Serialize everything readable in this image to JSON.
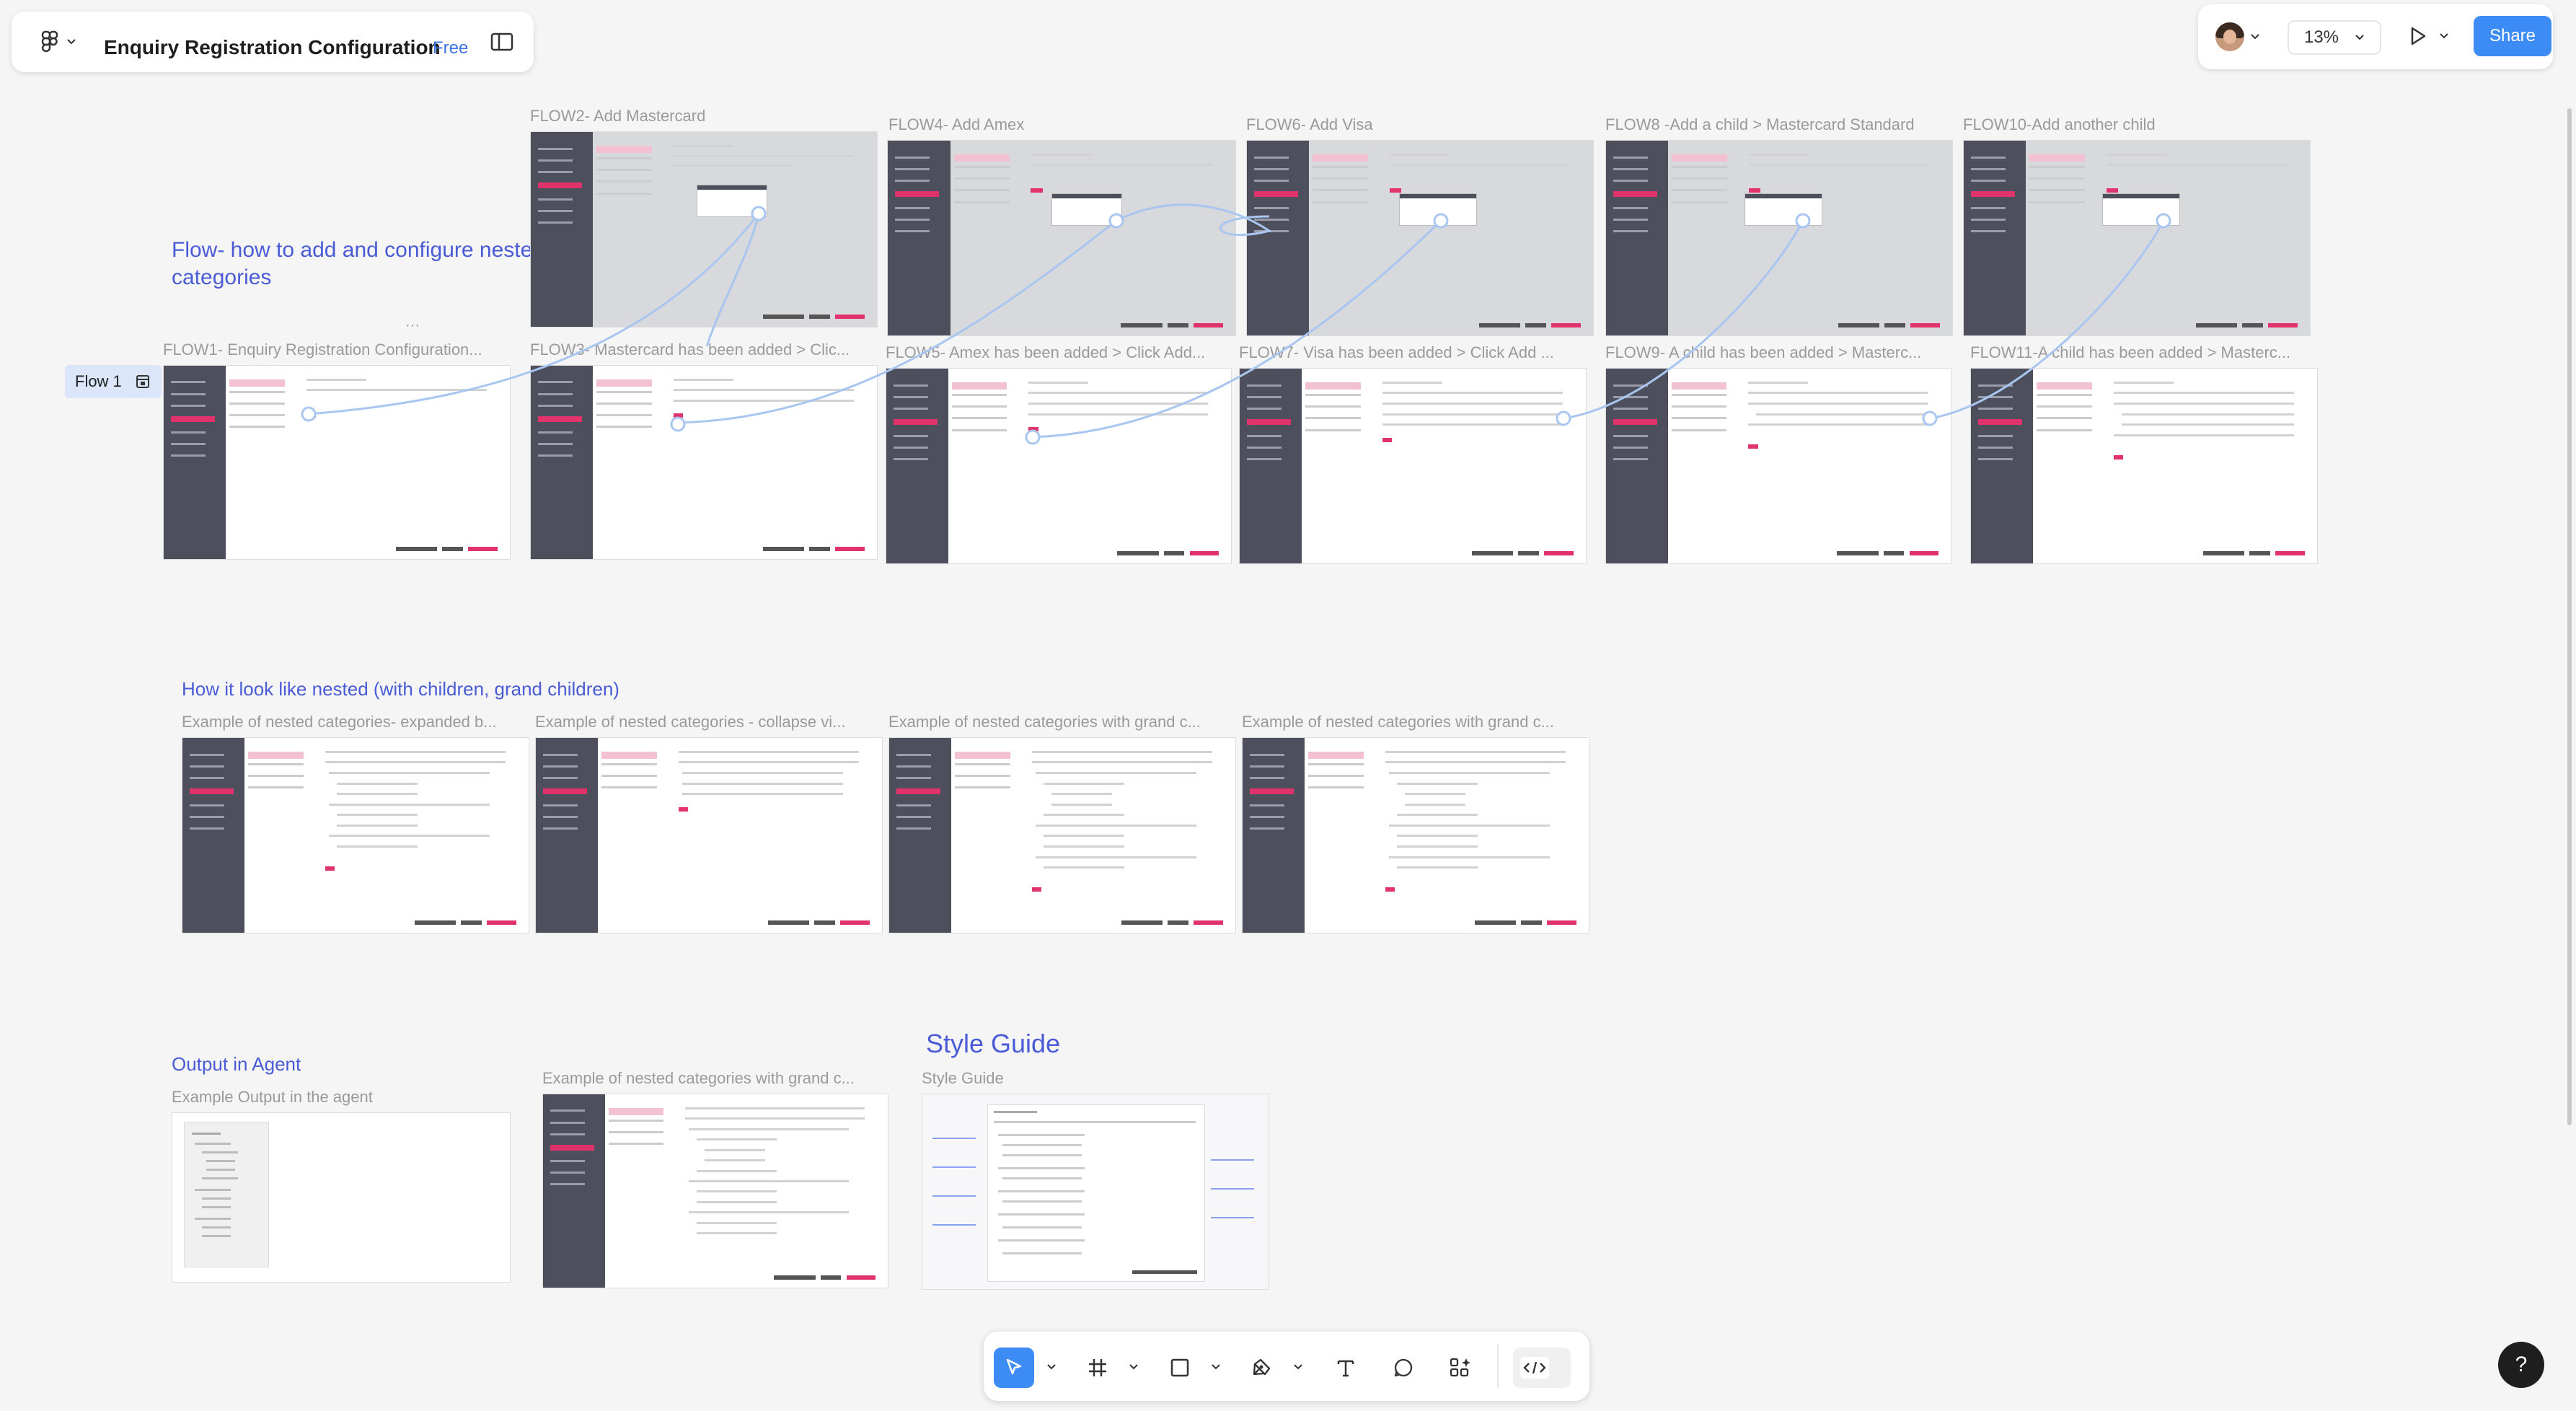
{
  "header": {
    "file_title": "Enquiry Registration Configuration",
    "plan_badge": "Free",
    "zoom": "13%",
    "share_label": "Share"
  },
  "canvas": {
    "flow_heading": "Flow- how to add and configure nested categories",
    "flow_tag": "Flow 1",
    "nested_heading": "How it look like nested (with children, grand children)",
    "output_heading": "Output in Agent",
    "style_heading": "Style Guide",
    "frames": {
      "flow1": "FLOW1-  Enquiry Registration Configuration...",
      "flow2": "FLOW2- Add Mastercard",
      "flow3": "FLOW3- Mastercard has been added > Clic...",
      "flow4": "FLOW4- Add Amex",
      "flow5": "FLOW5- Amex has been added > Click Add...",
      "flow6": "FLOW6- Add Visa",
      "flow7": "FLOW7- Visa has been added > Click Add ...",
      "flow8": "FLOW8 -Add a child  > Mastercard Standard",
      "flow9": "FLOW9- A child has been added > Masterc...",
      "flow10": "FLOW10-Add another child",
      "flow11": "FLOW11-A child has been added > Masterc...",
      "ex1": "Example of nested categories- expanded b...",
      "ex2": "Example of nested categories - collapse vi...",
      "ex3": "Example of nested categories with grand c...",
      "ex4": "Example of nested categories with grand c...",
      "output": "Example Output in the agent",
      "ex5": "Example of nested categories with grand c...",
      "style": "Style Guide"
    }
  },
  "toolbar": {
    "tools": [
      "move-tool",
      "frame-tool",
      "shape-tool",
      "pen-tool",
      "text-tool",
      "comment-tool",
      "actions-tool",
      "dev-mode-toggle"
    ]
  },
  "help_label": "?",
  "colors": {
    "accent": "#3d8cf5",
    "heading_blue": "#4a5bd6",
    "sidebar_dark": "#4d4f5c",
    "brand_pink": "#e0336b",
    "canvas_bg": "#f5f5f5"
  }
}
